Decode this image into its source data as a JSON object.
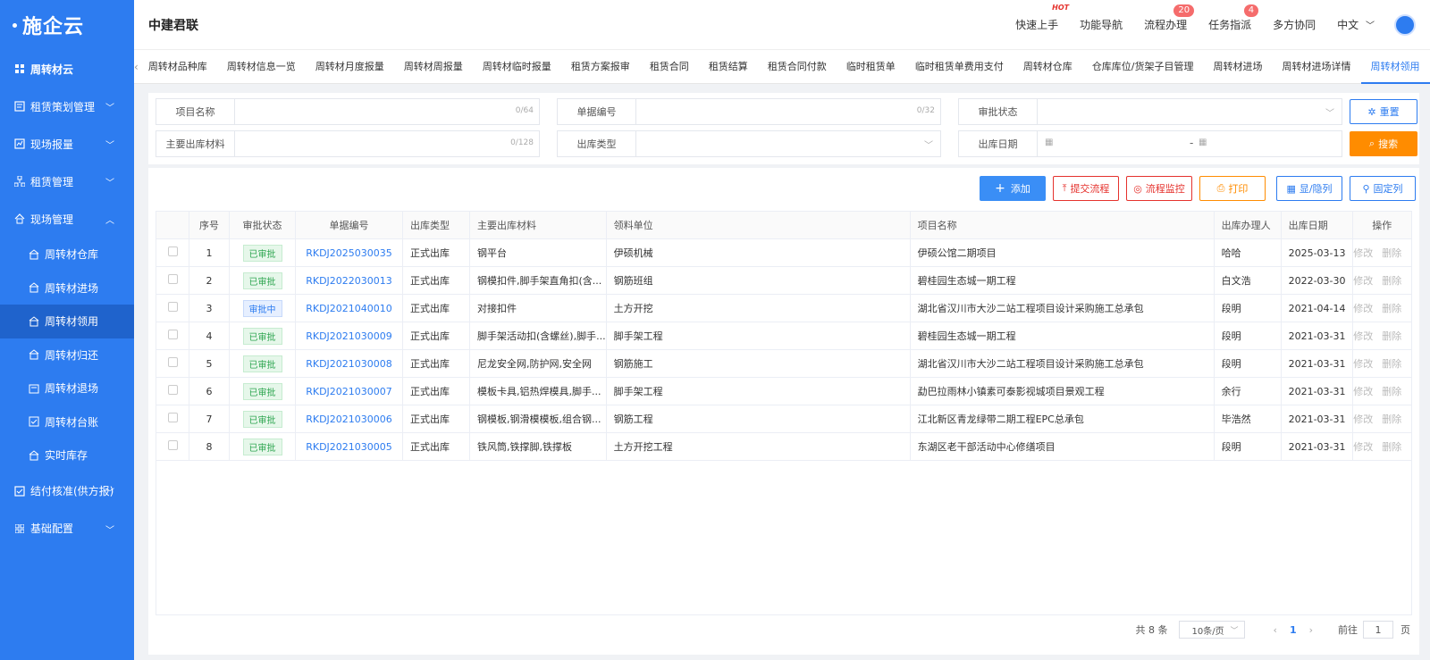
{
  "sidebar": {
    "logo": "施企云",
    "items": [
      {
        "label": "周转材云",
        "icon": "grid-icon",
        "has_children": false
      },
      {
        "label": "租赁策划管理",
        "icon": "plan-icon",
        "has_children": true
      },
      {
        "label": "现场报量",
        "icon": "chart-icon",
        "has_children": true
      },
      {
        "label": "租赁管理",
        "icon": "org-icon",
        "has_children": true
      },
      {
        "label": "现场管理",
        "icon": "home-icon",
        "has_children": true,
        "expanded": true
      }
    ],
    "sub_items": [
      "周转材仓库",
      "周转材进场",
      "周转材领用",
      "周转材归还",
      "周转材退场",
      "周转材台账",
      "实时库存"
    ],
    "bottom_items": [
      {
        "label": "结付核准(供方报)",
        "icon": "check-icon"
      },
      {
        "label": "基础配置",
        "icon": "apps-icon"
      }
    ]
  },
  "header": {
    "company": "中建君联",
    "links": [
      {
        "label": "快速上手",
        "hot": "HOT"
      },
      {
        "label": "功能导航"
      },
      {
        "label": "流程办理",
        "badge": "20"
      },
      {
        "label": "任务指派",
        "badge": "4"
      },
      {
        "label": "多方协同"
      }
    ],
    "lang": "中文"
  },
  "tabs": [
    "周转材品种库",
    "周转材信息一览",
    "周转材月度报量",
    "周转材周报量",
    "周转材临时报量",
    "租赁方案报审",
    "租赁合同",
    "租赁结算",
    "租赁合同付款",
    "临时租赁单",
    "临时租赁单费用支付",
    "周转材仓库",
    "仓库库位/货架子目管理",
    "周转材进场",
    "周转材进场详情",
    "周转材领用"
  ],
  "filters": {
    "project_name": {
      "label": "项目名称",
      "count": "0/64"
    },
    "doc_no": {
      "label": "单据编号",
      "count": "0/32"
    },
    "approval": {
      "label": "审批状态"
    },
    "material": {
      "label": "主要出库材料",
      "count": "0/128"
    },
    "out_type": {
      "label": "出库类型"
    },
    "out_date": {
      "label": "出库日期",
      "sep": "-"
    },
    "reset": "重置",
    "search": "搜索"
  },
  "toolbar": {
    "add": "添加",
    "submit": "提交流程",
    "monitor": "流程监控",
    "print": "打印",
    "toggle_cols": "显/隐列",
    "fix_cols": "固定列"
  },
  "table": {
    "headers": [
      "序号",
      "审批状态",
      "单据编号",
      "出库类型",
      "主要出库材料",
      "领料单位",
      "项目名称",
      "出库办理人",
      "出库日期",
      "操作"
    ],
    "rows": [
      {
        "no": "1",
        "status": "已审批",
        "code": "RKDJ2025030035",
        "type": "正式出库",
        "material": "钢平台",
        "unit": "伊硕机械",
        "project": "伊硕公馆二期项目",
        "handler": "哈哈",
        "date": "2025-03-13"
      },
      {
        "no": "2",
        "status": "已审批",
        "code": "RKDJ2022030013",
        "type": "正式出库",
        "material": "钢模扣件,脚手架直角扣(含...",
        "unit": "钢筋班组",
        "project": "碧桂园生态城一期工程",
        "handler": "白文浩",
        "date": "2022-03-30"
      },
      {
        "no": "3",
        "status": "审批中",
        "code": "RKDJ2021040010",
        "type": "正式出库",
        "material": "对接扣件",
        "unit": "土方开挖",
        "project": "湖北省汉川市大沙二站工程项目设计采购施工总承包",
        "handler": "段明",
        "date": "2021-04-14"
      },
      {
        "no": "4",
        "status": "已审批",
        "code": "RKDJ2021030009",
        "type": "正式出库",
        "material": "脚手架活动扣(含螺丝),脚手...",
        "unit": "脚手架工程",
        "project": "碧桂园生态城一期工程",
        "handler": "段明",
        "date": "2021-03-31"
      },
      {
        "no": "5",
        "status": "已审批",
        "code": "RKDJ2021030008",
        "type": "正式出库",
        "material": "尼龙安全网,防护网,安全网",
        "unit": "钢筋施工",
        "project": "湖北省汉川市大沙二站工程项目设计采购施工总承包",
        "handler": "段明",
        "date": "2021-03-31"
      },
      {
        "no": "6",
        "status": "已审批",
        "code": "RKDJ2021030007",
        "type": "正式出库",
        "material": "模板卡具,铝热焊模具,脚手...",
        "unit": "脚手架工程",
        "project": "勐巴拉雨林小镇素可泰影视城项目景观工程",
        "handler": "余行",
        "date": "2021-03-31"
      },
      {
        "no": "7",
        "status": "已审批",
        "code": "RKDJ2021030006",
        "type": "正式出库",
        "material": "钢模板,钢滑模模板,组合钢...",
        "unit": "钢筋工程",
        "project": "江北新区青龙绿带二期工程EPC总承包",
        "handler": "毕浩然",
        "date": "2021-03-31"
      },
      {
        "no": "8",
        "status": "已审批",
        "code": "RKDJ2021030005",
        "type": "正式出库",
        "material": "铁风筒,铁撑脚,铁撑板",
        "unit": "土方开挖工程",
        "project": "东湖区老干部活动中心修缮项目",
        "handler": "段明",
        "date": "2021-03-31"
      }
    ],
    "op_edit": "修改",
    "op_delete": "删除"
  },
  "pager": {
    "total": "共 8 条",
    "page_size": "10条/页",
    "current": "1",
    "goto_label": "前往",
    "goto_value": "1",
    "goto_suffix": "页"
  }
}
